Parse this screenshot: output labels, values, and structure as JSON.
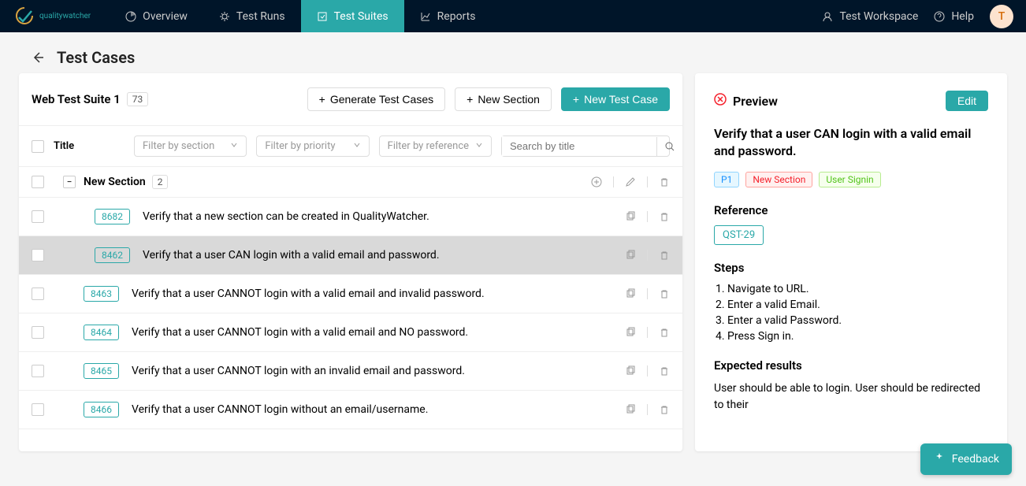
{
  "nav": {
    "logo_text": "qualitywatcher",
    "items": [
      {
        "label": "Overview",
        "icon": "pie"
      },
      {
        "label": "Test Runs",
        "icon": "gear"
      },
      {
        "label": "Test Suites",
        "icon": "suite",
        "active": true
      },
      {
        "label": "Reports",
        "icon": "chart"
      }
    ],
    "workspace": "Test Workspace",
    "help": "Help",
    "avatar": "T"
  },
  "page": {
    "title": "Test Cases"
  },
  "suite": {
    "title": "Web Test Suite 1",
    "count": "73",
    "actions": {
      "generate": "Generate Test Cases",
      "new_section": "New Section",
      "new_case": "New Test Case"
    }
  },
  "toolbar": {
    "col_title": "Title",
    "filter_section_ph": "Filter by section",
    "filter_priority_ph": "Filter by priority",
    "filter_reference_ph": "Filter by reference",
    "search_ph": "Search by title"
  },
  "section": {
    "name": "New Section",
    "count": "2"
  },
  "cases": [
    {
      "id": "8682",
      "title": "Verify that a new section can be created in QualityWatcher.",
      "indent": true,
      "selected": false
    },
    {
      "id": "8462",
      "title": "Verify that a user CAN login with a valid email and password.",
      "indent": true,
      "selected": true
    },
    {
      "id": "8463",
      "title": "Verify that a user CANNOT login with a valid email and invalid password.",
      "indent": false,
      "selected": false
    },
    {
      "id": "8464",
      "title": "Verify that a user CANNOT login with a valid email and NO password.",
      "indent": false,
      "selected": false
    },
    {
      "id": "8465",
      "title": "Verify that a user CANNOT login with an invalid email and password.",
      "indent": false,
      "selected": false
    },
    {
      "id": "8466",
      "title": "Verify that a user CANNOT login without an email/username.",
      "indent": false,
      "selected": false
    }
  ],
  "preview": {
    "label": "Preview",
    "edit": "Edit",
    "title": "Verify that a user CAN login with a valid email and password.",
    "tags": {
      "priority": "P1",
      "section": "New Section",
      "feature": "User Signin"
    },
    "reference_label": "Reference",
    "reference": "QST-29",
    "steps_label": "Steps",
    "steps": [
      "1. Navigate to URL.",
      "2. Enter a valid Email.",
      "3. Enter a valid Password.",
      "4. Press Sign in."
    ],
    "expected_label": "Expected results",
    "expected": "User should be able to login. User should be redirected to their"
  },
  "feedback": "Feedback"
}
